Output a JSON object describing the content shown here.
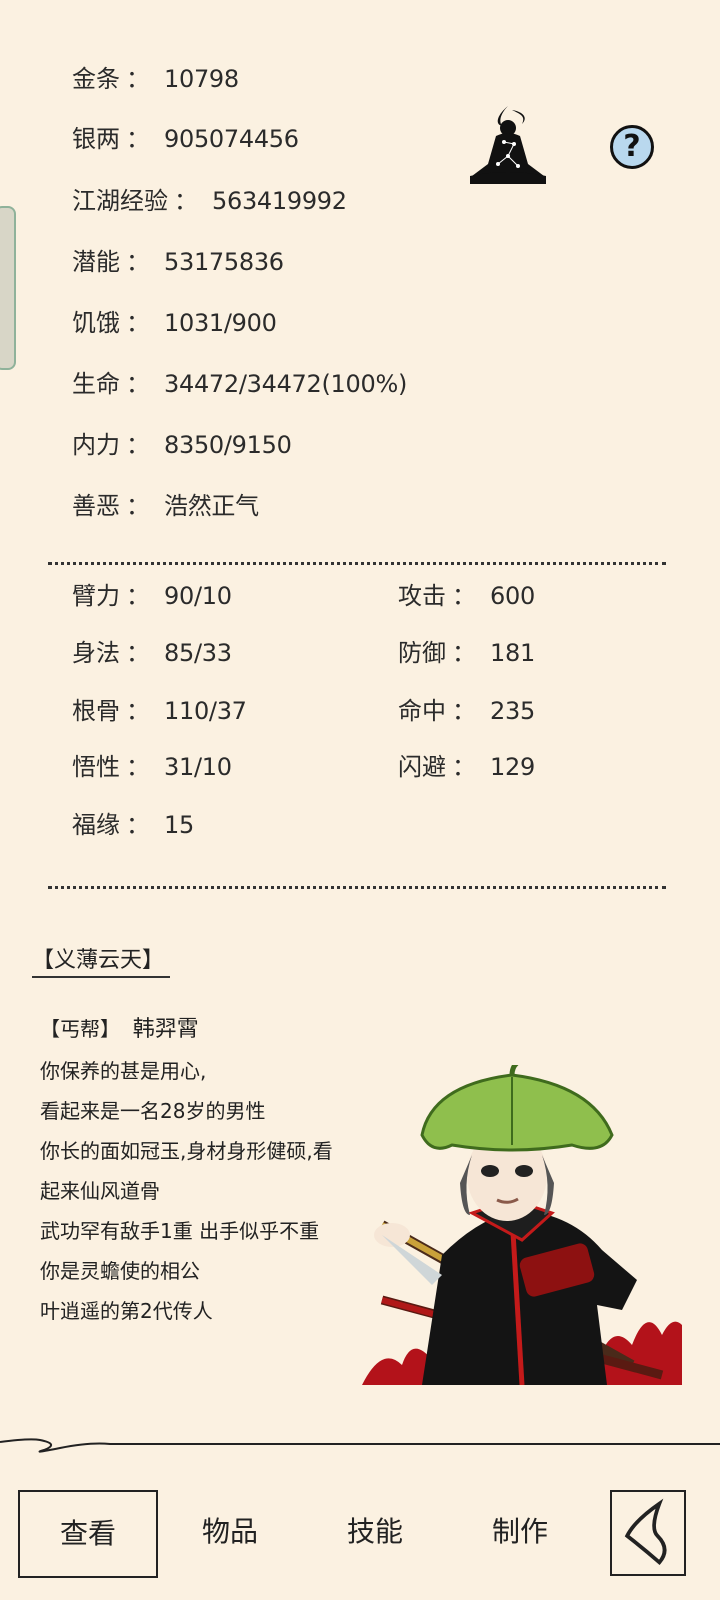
{
  "stats": {
    "sep": "：",
    "gold": {
      "label": "金条",
      "value": "10798"
    },
    "silver": {
      "label": "银两",
      "value": "905074456"
    },
    "exp": {
      "label": "江湖经验",
      "value": "563419992"
    },
    "potential": {
      "label": "潜能",
      "value": "53175836"
    },
    "hunger": {
      "label": "饥饿",
      "value": "1031/900"
    },
    "life": {
      "label": "生命",
      "value": "34472/34472(100%)"
    },
    "internal": {
      "label": "内力",
      "value": "8350/9150"
    },
    "morality": {
      "label": "善恶",
      "value": "浩然正气"
    }
  },
  "attributes": {
    "strength": {
      "label": "臂力",
      "value": "90/10"
    },
    "agility": {
      "label": "身法",
      "value": "85/33"
    },
    "constitution": {
      "label": "根骨",
      "value": "110/37"
    },
    "comprehension": {
      "label": "悟性",
      "value": "31/10"
    },
    "luck": {
      "label": "福缘",
      "value": "15"
    },
    "attack": {
      "label": "攻击",
      "value": "600"
    },
    "defense": {
      "label": "防御",
      "value": "181"
    },
    "hit": {
      "label": "命中",
      "value": "235"
    },
    "dodge": {
      "label": "闪避",
      "value": "129"
    }
  },
  "profile": {
    "title": "【义薄云天】",
    "sect": "【丐帮】",
    "name": "韩羿霄",
    "lines": [
      "你保养的甚是用心,",
      "看起来是一名28岁的男性",
      "你长的面如冠玉,身材身形健硕,看",
      "起来仙风道骨",
      "武功罕有敌手1重 出手似乎不重",
      "你是灵蟾使的相公",
      "叶逍遥的第2代传人"
    ]
  },
  "help_label": "?",
  "nav": {
    "view": "查看",
    "items": "物品",
    "skills": "技能",
    "craft": "制作"
  }
}
